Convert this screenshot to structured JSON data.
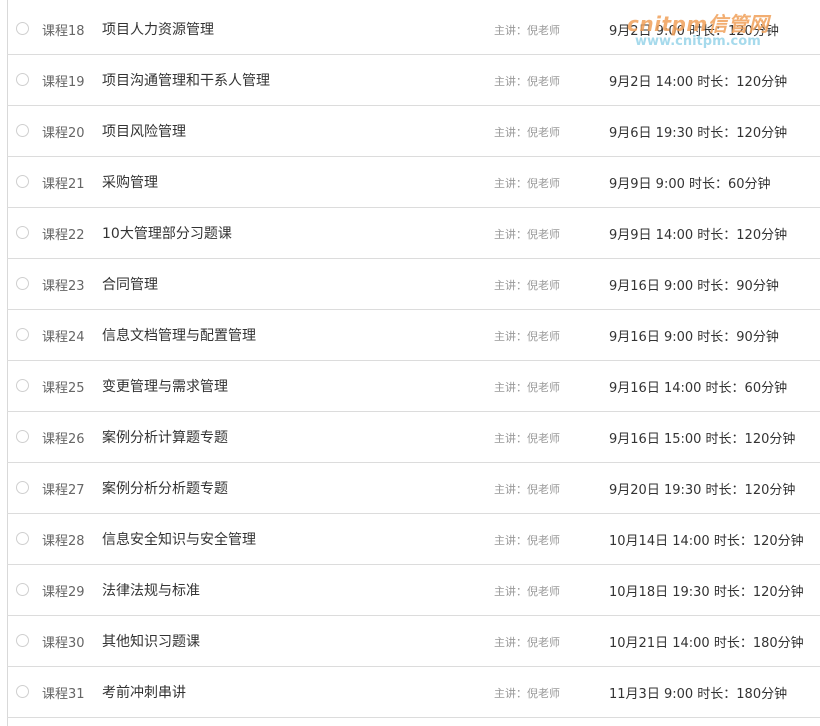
{
  "courses": [
    {
      "num": "课程18",
      "title": "项目人力资源管理",
      "teacher": "主讲：倪老师",
      "time": "9月2日 9:00 时长：120分钟"
    },
    {
      "num": "课程19",
      "title": "项目沟通管理和干系人管理",
      "teacher": "主讲：倪老师",
      "time": "9月2日 14:00 时长：120分钟"
    },
    {
      "num": "课程20",
      "title": "项目风险管理",
      "teacher": "主讲：倪老师",
      "time": "9月6日 19:30 时长：120分钟"
    },
    {
      "num": "课程21",
      "title": "采购管理",
      "teacher": "主讲：倪老师",
      "time": "9月9日 9:00 时长：60分钟"
    },
    {
      "num": "课程22",
      "title": "10大管理部分习题课",
      "teacher": "主讲：倪老师",
      "time": "9月9日 14:00 时长：120分钟"
    },
    {
      "num": "课程23",
      "title": "合同管理",
      "teacher": "主讲：倪老师",
      "time": "9月16日 9:00 时长：90分钟"
    },
    {
      "num": "课程24",
      "title": "信息文档管理与配置管理",
      "teacher": "主讲：倪老师",
      "time": "9月16日 9:00 时长：90分钟"
    },
    {
      "num": "课程25",
      "title": "变更管理与需求管理",
      "teacher": "主讲：倪老师",
      "time": "9月16日 14:00 时长：60分钟"
    },
    {
      "num": "课程26",
      "title": "案例分析计算题专题",
      "teacher": "主讲：倪老师",
      "time": "9月16日 15:00 时长：120分钟"
    },
    {
      "num": "课程27",
      "title": "案例分析分析题专题",
      "teacher": "主讲：倪老师",
      "time": "9月20日 19:30 时长：120分钟"
    },
    {
      "num": "课程28",
      "title": "信息安全知识与安全管理",
      "teacher": "主讲：倪老师",
      "time": "10月14日 14:00 时长：120分钟"
    },
    {
      "num": "课程29",
      "title": "法律法规与标准",
      "teacher": "主讲：倪老师",
      "time": "10月18日 19:30 时长：120分钟"
    },
    {
      "num": "课程30",
      "title": "其他知识习题课",
      "teacher": "主讲：倪老师",
      "time": "10月21日 14:00 时长：180分钟"
    },
    {
      "num": "课程31",
      "title": "考前冲刺串讲",
      "teacher": "主讲：倪老师",
      "time": "11月3日 9:00 时长：180分钟"
    }
  ],
  "watermark": {
    "brand": "cnitpm信管网",
    "url": "www.cnitpm.com"
  },
  "colors": {
    "row_border": "#dcdcdc",
    "teacher_text": "#999999",
    "watermark_orange": "#f0a15a",
    "watermark_blue": "#9dd6ea"
  }
}
